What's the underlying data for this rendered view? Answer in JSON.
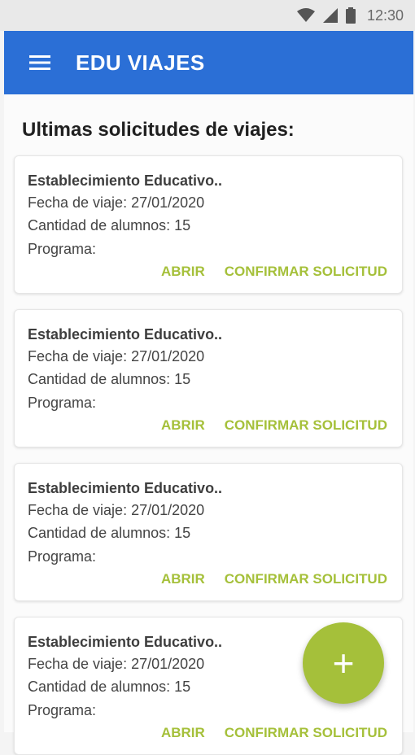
{
  "status_bar": {
    "time": "12:30"
  },
  "app_bar": {
    "title": "EDU VIAJES"
  },
  "main": {
    "section_title": "Ultimas solicitudes de viajes:",
    "cards": [
      {
        "school": "Establecimiento Educativo..",
        "date": "Fecha de viaje: 27/01/2020",
        "count": "Cantidad de alumnos: 15",
        "program": "Programa:",
        "open_label": "ABRIR",
        "confirm_label": "CONFIRMAR SOLICITUD"
      },
      {
        "school": "Establecimiento Educativo..",
        "date": "Fecha de viaje: 27/01/2020",
        "count": "Cantidad de alumnos: 15",
        "program": "Programa:",
        "open_label": "ABRIR",
        "confirm_label": "CONFIRMAR SOLICITUD"
      },
      {
        "school": "Establecimiento Educativo..",
        "date": "Fecha de viaje: 27/01/2020",
        "count": "Cantidad de alumnos: 15",
        "program": "Programa:",
        "open_label": "ABRIR",
        "confirm_label": "CONFIRMAR SOLICITUD"
      },
      {
        "school": "Establecimiento Educativo..",
        "date": "Fecha de viaje: 27/01/2020",
        "count": "Cantidad de alumnos: 15",
        "program": "Programa:",
        "open_label": "ABRIR",
        "confirm_label": "CONFIRMAR SOLICITUD"
      }
    ]
  },
  "fab": {
    "icon": "plus-icon",
    "symbol": "+"
  },
  "colors": {
    "primary": "#2b6fd6",
    "accent": "#a5c03a"
  }
}
